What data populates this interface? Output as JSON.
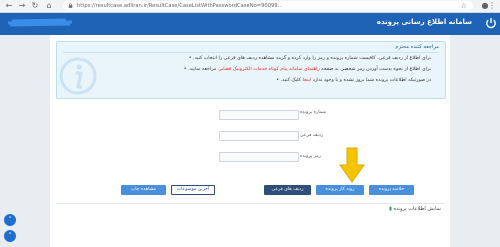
{
  "browser": {
    "url": "https://resultcase.adliran.ir/ResultCase/CaseListWithPasswordCaseNo=90099..."
  },
  "app_header": {
    "title": "سامانه اطلاع رسانی پرونده"
  },
  "info_box": {
    "title": "مراجعه کننده محترم",
    "lines": [
      {
        "text": "برای اطلاع از ردیف فرعی، کافیست شماره پرونده و رمز را وارد کرده و گزینه مشاهده ردیف های فرعی را انتخاب کنید."
      },
      {
        "before": "برای اطلاع از نحوه بدست آوردن رمز شخصی به صفحه ",
        "link": "راهنمای سامانه پیام کوتاه خدمات الکترونیک قضایی",
        "after": " مراجعه نمایید."
      },
      {
        "before": "در صورتیکه اطلاعات پرونده شما بروز نشده و یا وجود ندارد ",
        "link": "اینجا",
        "after": " کلیک کنید."
      }
    ]
  },
  "form": {
    "case_number_label": "شماره پرونده",
    "sub_row_label": "ردیف فرعی",
    "password_label": "رمز پرونده"
  },
  "buttons": {
    "case_history": "خلاصه پرونده",
    "case_procedure": "روند کار پرونده",
    "sub_rows": "ردیف های فرعی",
    "latest_notices": "آخرین موضوعات",
    "print_view": "مشاهده چاپ"
  },
  "section": {
    "title": "نمایش اطلاعات پرونده"
  },
  "colors": {
    "header_blue": "#1e63b5",
    "button_blue": "#4a8fdc",
    "button_navy": "#2f4e7a",
    "arrow_yellow": "#f5c400",
    "link_red": "#d6261c"
  },
  "icons": {
    "power": "power-icon",
    "info": "info-icon",
    "arrow": "down-arrow-icon",
    "fab_up": "chevron-up-icon",
    "fab_down": "chevron-down-icon"
  }
}
